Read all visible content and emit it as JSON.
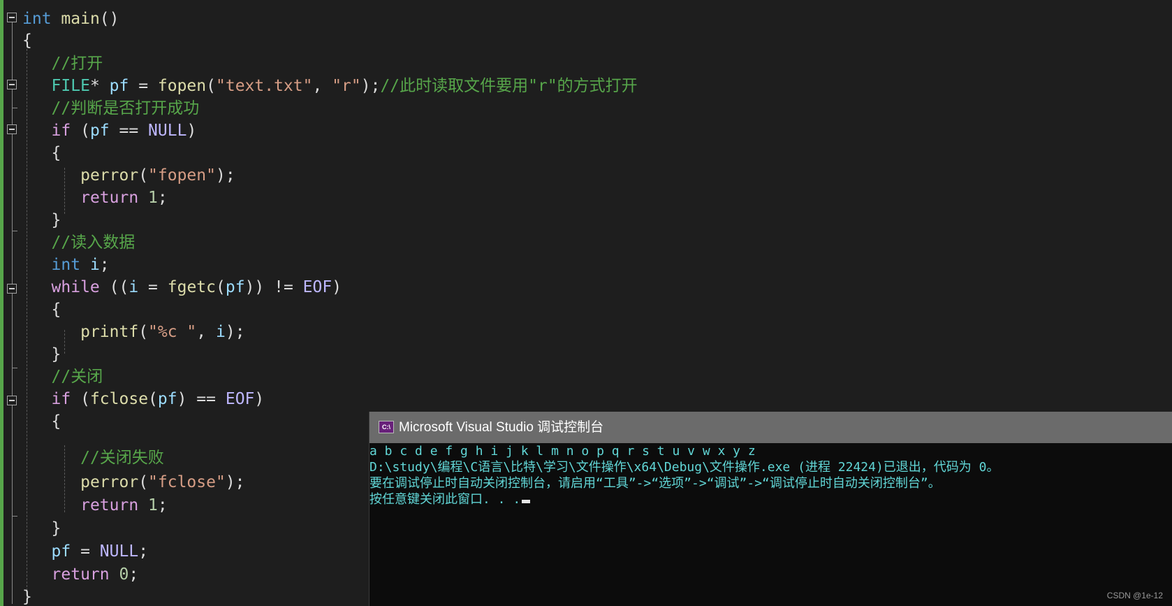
{
  "code": {
    "l1_kw": "int",
    "l1_fn": "main",
    "l1_punc": "()",
    "l2": "{",
    "l3_cmt": "//打开",
    "l4_type": "FILE",
    "l4_star": "* ",
    "l4_var": "pf",
    "l4_eq": " = ",
    "l4_fn": "fopen",
    "l4_p1": "(",
    "l4_s1": "\"text.txt\"",
    "l4_comma": ", ",
    "l4_s2": "\"r\"",
    "l4_p2": ");",
    "l4_cmt": "//此时读取文件要用\"r\"的方式打开",
    "l5_cmt": "//判断是否打开成功",
    "l6_kw": "if",
    "l6_p1": " (",
    "l6_var": "pf",
    "l6_op": " == ",
    "l6_mac": "NULL",
    "l6_p2": ")",
    "l7": "{",
    "l8_fn": "perror",
    "l8_p1": "(",
    "l8_str": "\"fopen\"",
    "l8_p2": ");",
    "l9_kw": "return",
    "l9_num": " 1",
    "l9_p": ";",
    "l10": "}",
    "l11_cmt": "//读入数据",
    "l12_kw": "int",
    "l12_var": " i",
    "l12_p": ";",
    "l13_kw": "while",
    "l13_p1": " ((",
    "l13_var": "i",
    "l13_eq": " = ",
    "l13_fn": "fgetc",
    "l13_p2": "(",
    "l13_var2": "pf",
    "l13_p3": ")) != ",
    "l13_mac": "EOF",
    "l13_p4": ")",
    "l14": "{",
    "l15_fn": "printf",
    "l15_p1": "(",
    "l15_str": "\"%c \"",
    "l15_comma": ", ",
    "l15_var": "i",
    "l15_p2": ");",
    "l16": "}",
    "l17_cmt": "//关闭",
    "l18_kw": "if",
    "l18_p1": " (",
    "l18_fn": "fclose",
    "l18_p2": "(",
    "l18_var": "pf",
    "l18_p3": ") == ",
    "l18_mac": "EOF",
    "l18_p4": ")",
    "l19": "{",
    "l20_cmt": "//关闭失败",
    "l21_fn": "perror",
    "l21_p1": "(",
    "l21_str": "\"fclose\"",
    "l21_p2": ");",
    "l22_kw": "return",
    "l22_num": " 1",
    "l22_p": ";",
    "l23": "}",
    "l24_var": "pf",
    "l24_eq": " = ",
    "l24_mac": "NULL",
    "l24_p": ";",
    "l25_kw": "return",
    "l25_num": " 0",
    "l25_p": ";",
    "l26": "}"
  },
  "console": {
    "icon_text": "C:\\",
    "title": "Microsoft Visual Studio 调试控制台",
    "lines": [
      "a b c d e f g h i j k l m n o p q r s t u v w x y z",
      "D:\\study\\编程\\C语言\\比特\\学习\\文件操作\\x64\\Debug\\文件操作.exe (进程 22424)已退出，代码为 0。",
      "要在调试停止时自动关闭控制台，请启用“工具”->“选项”->“调试”->“调试停止时自动关闭控制台”。",
      "按任意键关闭此窗口. . ."
    ]
  },
  "watermark": "CSDN @1e-12",
  "colors": {
    "background": "#1e1e1e",
    "keyword": "#569cd6",
    "control_keyword": "#d8a0df",
    "function": "#dcdcaa",
    "variable": "#9cdcfe",
    "macro": "#beb7ff",
    "string": "#d69d85",
    "comment": "#57a64a",
    "console_text": "#61d6d6"
  }
}
